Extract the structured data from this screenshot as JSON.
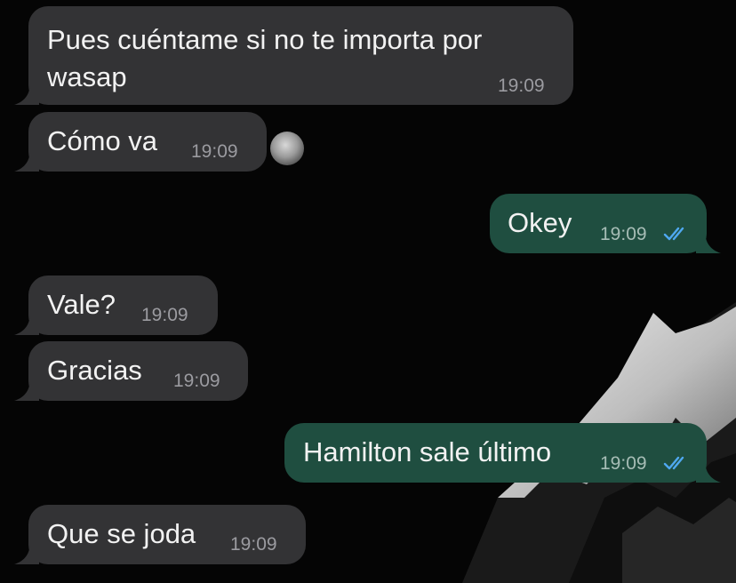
{
  "colors": {
    "incoming_bubble": "#333335",
    "outgoing_bubble": "#1f4e40",
    "read_ticks": "#4fa8f0",
    "wallpaper": "#050505"
  },
  "messages": [
    {
      "direction": "incoming",
      "lines": [
        "Pues cuéntame si no te importa por",
        "wasap"
      ],
      "time": "19:09"
    },
    {
      "direction": "incoming",
      "lines": [
        "Cómo va"
      ],
      "time": "19:09"
    },
    {
      "direction": "outgoing",
      "lines": [
        "Okey"
      ],
      "time": "19:09",
      "status_icon": "double-check-read-icon"
    },
    {
      "direction": "incoming",
      "lines": [
        "Vale?"
      ],
      "time": "19:09"
    },
    {
      "direction": "incoming",
      "lines": [
        "Gracias"
      ],
      "time": "19:09"
    },
    {
      "direction": "outgoing",
      "lines": [
        "Hamilton sale último"
      ],
      "time": "19:09",
      "status_icon": "double-check-read-icon"
    },
    {
      "direction": "incoming",
      "lines": [
        "Que se joda"
      ],
      "time": "19:09"
    }
  ]
}
